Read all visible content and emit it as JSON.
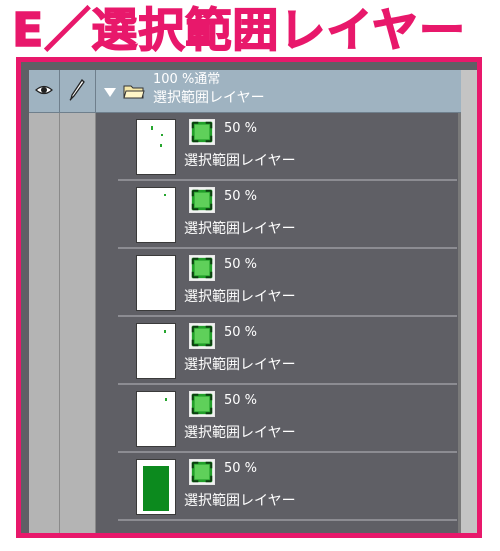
{
  "heading": "E／選択範囲レイヤー",
  "group": {
    "mode_line": "100 %通常",
    "name": "選択範囲レイヤー"
  },
  "layers": [
    {
      "opacity": "50 %",
      "name": "選択範囲レイヤー"
    },
    {
      "opacity": "50 %",
      "name": "選択範囲レイヤー"
    },
    {
      "opacity": "50 %",
      "name": "選択範囲レイヤー"
    },
    {
      "opacity": "50 %",
      "name": "選択範囲レイヤー"
    },
    {
      "opacity": "50 %",
      "name": "選択範囲レイヤー"
    },
    {
      "opacity": "50 %",
      "name": "選択範囲レイヤー"
    }
  ],
  "icons": {
    "visibility": "eye-icon",
    "lock": "pen-icon",
    "expand": "triangle-down-icon",
    "folder": "folder-icon",
    "selection_mask": "selection-mask-icon"
  },
  "colors": {
    "highlight": "#e8186b",
    "selection_green": "#0c8a1e",
    "header_blue": "#9fb3c1",
    "panel_bg": "#5f5f65"
  }
}
